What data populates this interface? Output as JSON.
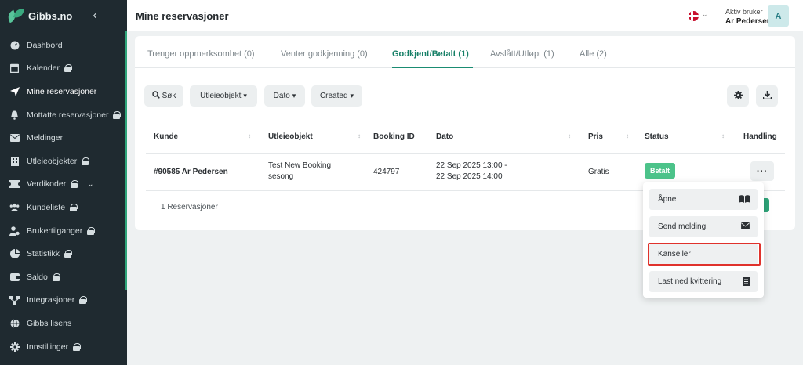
{
  "app": {
    "name": "Gibbs.no"
  },
  "sidebar": {
    "items": [
      {
        "label": "Dashbord",
        "icon": "speedometer-icon",
        "locked": false
      },
      {
        "label": "Kalender",
        "icon": "calendar-icon",
        "locked": true
      },
      {
        "label": "Mine reservasjoner",
        "icon": "send-icon",
        "locked": false,
        "active": true
      },
      {
        "label": "Mottatte reservasjoner",
        "icon": "bell-icon",
        "locked": true
      },
      {
        "label": "Meldinger",
        "icon": "envelope-icon",
        "locked": false
      },
      {
        "label": "Utleieobjekter",
        "icon": "building-icon",
        "locked": true
      },
      {
        "label": "Verdikoder",
        "icon": "ticket-icon",
        "locked": true,
        "expandable": true
      },
      {
        "label": "Kundeliste",
        "icon": "users-icon",
        "locked": true
      },
      {
        "label": "Brukertilganger",
        "icon": "user-cog-icon",
        "locked": true
      },
      {
        "label": "Statistikk",
        "icon": "pie-chart-icon",
        "locked": true
      },
      {
        "label": "Saldo",
        "icon": "wallet-icon",
        "locked": true
      },
      {
        "label": "Integrasjoner",
        "icon": "network-icon",
        "locked": true
      },
      {
        "label": "Gibbs lisens",
        "icon": "globe-icon",
        "locked": false
      },
      {
        "label": "Innstillinger",
        "icon": "gear-icon",
        "locked": true
      }
    ]
  },
  "header": {
    "title": "Mine reservasjoner",
    "user_role": "Aktiv bruker",
    "user_name": "Ar Pedersen",
    "avatar_initial": "A"
  },
  "tabs": [
    {
      "label": "Trenger oppmerksomhet (0)"
    },
    {
      "label": "Venter godkjenning (0)"
    },
    {
      "label": "Godkjent/Betalt (1)",
      "active": true
    },
    {
      "label": "Avslått/Utløpt (1)"
    },
    {
      "label": "Alle (2)"
    }
  ],
  "filters": {
    "search": "Søk",
    "object": "Utleieobjekt",
    "date": "Dato",
    "created": "Created"
  },
  "table": {
    "headers": [
      "Kunde",
      "Utleieobjekt",
      "Booking ID",
      "Dato",
      "Pris",
      "Status",
      "Handling"
    ],
    "rows": [
      {
        "customer": "#90585 Ar Pedersen",
        "object_line1": "Test New Booking",
        "object_line2": "sesong",
        "booking_id": "424797",
        "date_line1": "22 Sep 2025 13:00 -",
        "date_line2": "22 Sep 2025 14:00",
        "price": "Gratis",
        "status": "Betalt"
      }
    ],
    "count_text": "1 Reservasjoner"
  },
  "action_menu": {
    "trigger": "···",
    "items": [
      {
        "label": "Åpne",
        "icon": "book-open-icon"
      },
      {
        "label": "Send melding",
        "icon": "envelope-icon"
      },
      {
        "label": "Kanseller",
        "icon": "",
        "highlighted": true
      },
      {
        "label": "Last ned kvittering",
        "icon": "receipt-icon"
      }
    ]
  },
  "colors": {
    "sidebar_bg": "#1f2a30",
    "accent_green": "#1a8c72",
    "status_paid": "#4cc38a",
    "highlight_red": "#e0322c"
  }
}
